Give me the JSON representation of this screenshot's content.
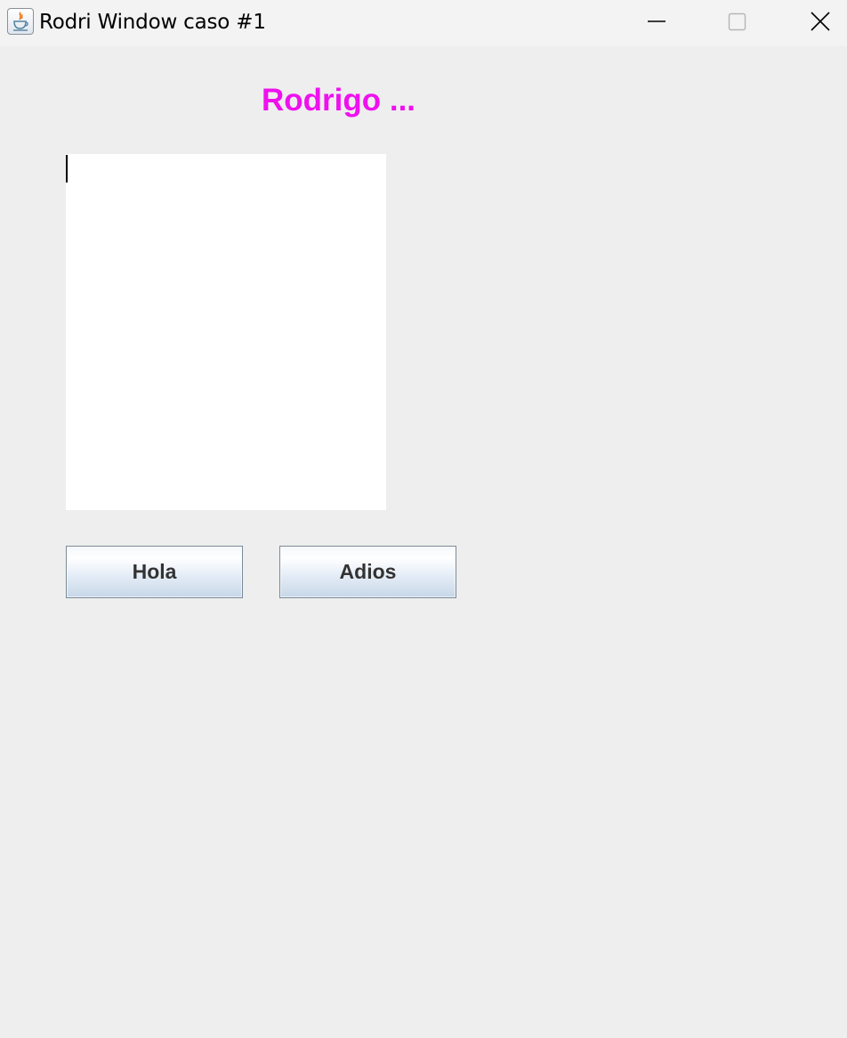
{
  "window": {
    "title": "Rodri Window caso #1",
    "icon": "java-icon",
    "controls": [
      "minimize-icon",
      "maximize-icon",
      "close-icon"
    ]
  },
  "main": {
    "heading": "Rodrigo ...",
    "heading_color": "#ee11ee",
    "text_area_value": "",
    "buttons": {
      "hola_label": "Hola",
      "adios_label": "Adios"
    }
  },
  "colors": {
    "window_background": "#eeeeee",
    "title_bar": "#f3f3f3",
    "button_text": "#333333"
  }
}
